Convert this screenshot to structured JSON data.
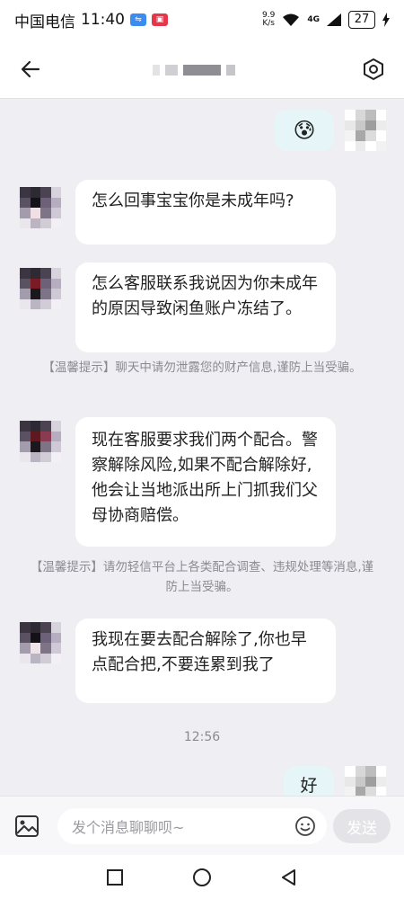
{
  "status_bar": {
    "carrier": "中国电信",
    "time": "11:40",
    "net_speed_value": "9.9",
    "net_speed_unit": "K/s",
    "network": "4G",
    "battery": "27"
  },
  "header": {
    "back_icon": "back-arrow-icon",
    "settings_icon": "settings-hexagon-icon"
  },
  "messages": [
    {
      "side": "right",
      "text": "😰"
    },
    {
      "side": "left",
      "text": "怎么回事宝宝你是未成年吗?"
    },
    {
      "side": "left",
      "text": "怎么客服联系我说因为你未成年的原因导致闲鱼账户冻结了。"
    },
    {
      "side": "left",
      "text": "现在客服要求我们两个配合。警察解除风险,如果不配合解除好,他会让当地派出所上门抓我们父母协商赔偿。"
    },
    {
      "side": "left",
      "text": "我现在要去配合解除了,你也早点配合把,不要连累到我了"
    },
    {
      "side": "right",
      "text": "好"
    }
  ],
  "tips": [
    "【温馨提示】聊天中请勿泄露您的财产信息,谨防上当受骗。",
    "【温馨提示】请勿轻信平台上各类配合调查、违规处理等消息,谨防上当受骗。"
  ],
  "timestamp": "12:56",
  "input": {
    "placeholder": "发个消息聊聊呗~",
    "send_label": "发送"
  },
  "colors": {
    "background": "#efeff3",
    "bubble_left": "#ffffff",
    "bubble_right": "#e6f6f8",
    "tip_text": "#8a8a90"
  }
}
